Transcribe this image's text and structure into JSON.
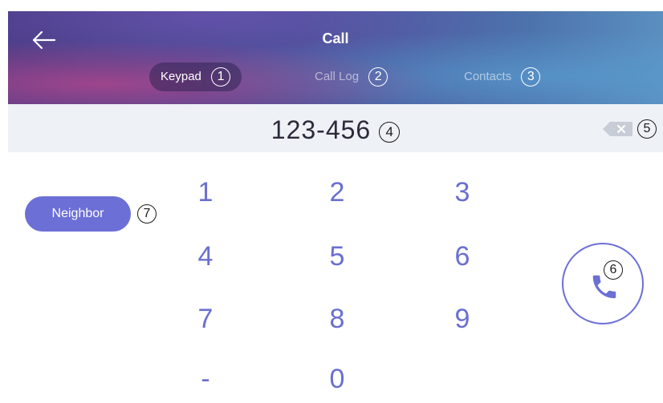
{
  "header": {
    "title": "Call",
    "back_icon": "arrow-left-icon",
    "tabs": [
      {
        "label": "Keypad",
        "marker": "1",
        "active": true
      },
      {
        "label": "Call Log",
        "marker": "2",
        "active": false
      },
      {
        "label": "Contacts",
        "marker": "3",
        "active": false
      }
    ]
  },
  "number_bar": {
    "value": "123-456",
    "value_marker": "4",
    "delete_icon": "backspace-icon",
    "delete_marker": "5"
  },
  "neighbor": {
    "label": "Neighbor",
    "marker": "7"
  },
  "keypad": {
    "keys": [
      "1",
      "2",
      "3",
      "4",
      "5",
      "6",
      "7",
      "8",
      "9",
      "-",
      "0"
    ]
  },
  "call_button": {
    "icon": "phone-icon",
    "marker": "6"
  },
  "colors": {
    "accent": "#6c6fd6",
    "key_text": "#6a6fd0",
    "number_bar_bg": "#eef1f6"
  }
}
